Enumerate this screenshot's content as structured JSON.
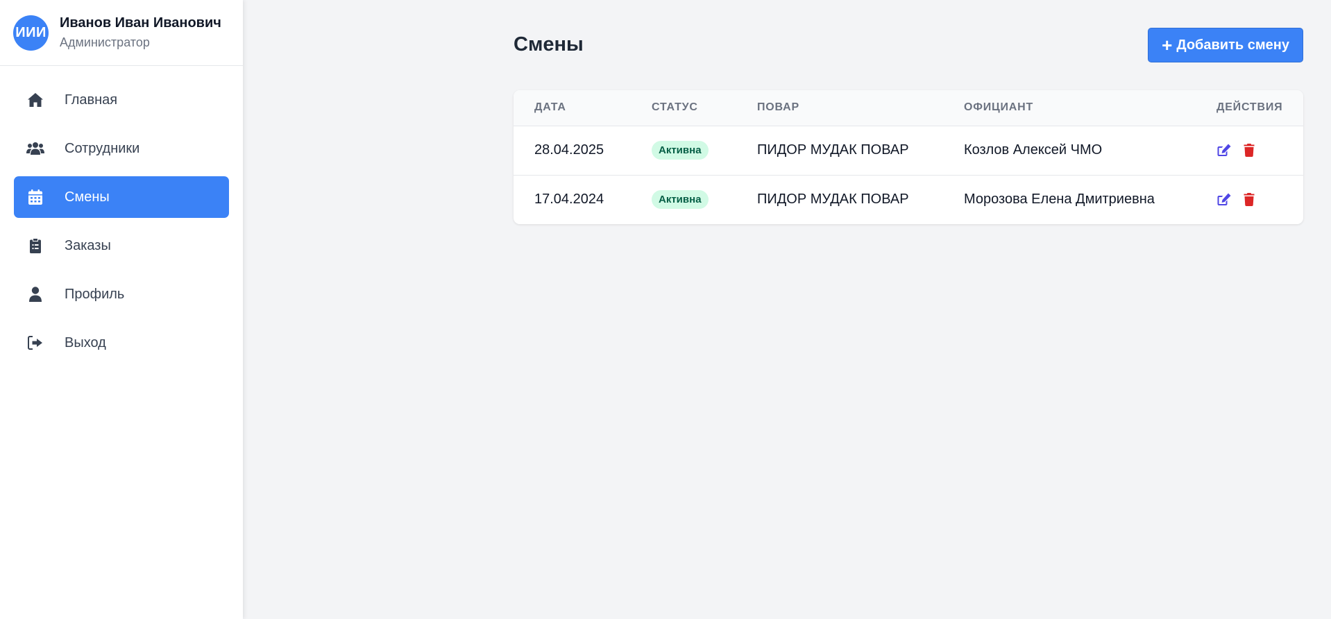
{
  "user": {
    "initials": "ИИИ",
    "name": "Иванов Иван Иванович",
    "role": "Администратор"
  },
  "sidebar": {
    "items": [
      {
        "label": "Главная",
        "icon": "home-icon"
      },
      {
        "label": "Сотрудники",
        "icon": "users-icon"
      },
      {
        "label": "Смены",
        "icon": "calendar-icon",
        "active": true
      },
      {
        "label": "Заказы",
        "icon": "clipboard-icon"
      },
      {
        "label": "Профиль",
        "icon": "user-icon"
      },
      {
        "label": "Выход",
        "icon": "logout-icon"
      }
    ]
  },
  "page": {
    "title": "Смены",
    "add_button_label": "Добавить смену"
  },
  "table": {
    "headers": {
      "date": "Дата",
      "status": "Статус",
      "cook": "Повар",
      "waiter": "Официант",
      "actions": "Действия"
    },
    "rows": [
      {
        "date": "28.04.2025",
        "status": "Активна",
        "cook": "ПИДОР МУДАК ПОВАР",
        "waiter": "Козлов Алексей ЧМО"
      },
      {
        "date": "17.04.2024",
        "status": "Активна",
        "cook": "ПИДОР МУДАК ПОВАР",
        "waiter": "Морозова Елена Дмитриевна"
      }
    ]
  },
  "colors": {
    "accent": "#3b82f6",
    "edit_icon": "#4f46e5",
    "delete_icon": "#dc2626",
    "status_bg": "#d1fae5",
    "status_text": "#065f46"
  }
}
